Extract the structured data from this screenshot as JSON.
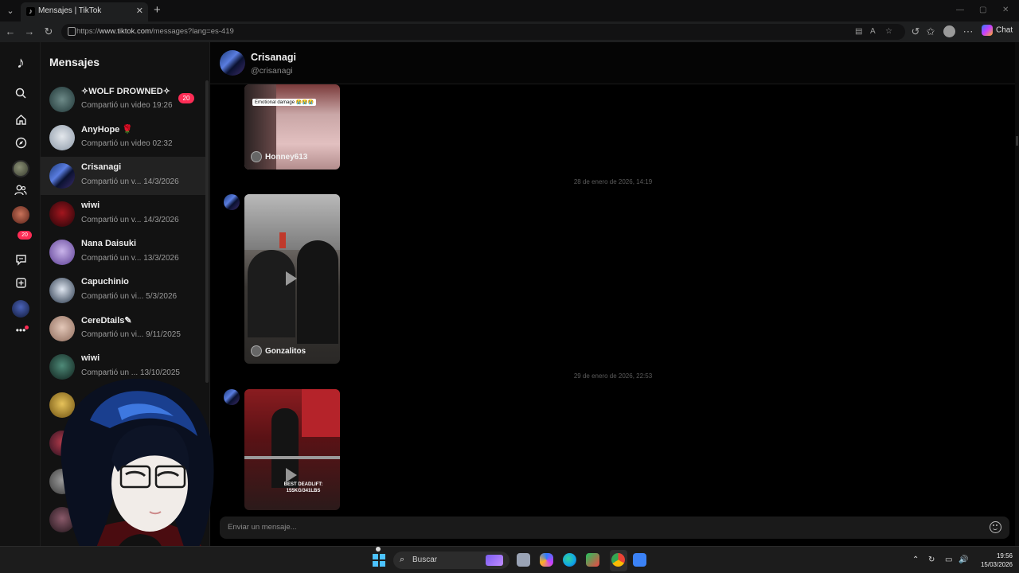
{
  "browser": {
    "tab_title": "Mensajes | TikTok",
    "url_prefix": "https://",
    "url_host": "www.tiktok.com",
    "url_path": "/messages?lang=es-419",
    "chat_label": "Chat"
  },
  "rail": {
    "badge": "20"
  },
  "conversations": {
    "title": "Mensajes",
    "items": [
      {
        "name": "✧WOLF DROWNED✧",
        "preview": "Compartió un video",
        "time": "19:26",
        "badge": "20"
      },
      {
        "name": "AnyHope 🌹",
        "preview": "Compartió un video",
        "time": "02:32"
      },
      {
        "name": "Crisanagi",
        "preview": "Compartió un v...",
        "time": "14/3/2026"
      },
      {
        "name": "wiwi",
        "preview": "Compartió un v...",
        "time": "14/3/2026"
      },
      {
        "name": "Nana Daisuki",
        "preview": "Compartió un v...",
        "time": "13/3/2026"
      },
      {
        "name": "Capuchinio",
        "preview": "Compartió un vi...",
        "time": "5/3/2026"
      },
      {
        "name": "CereDtails✎",
        "preview": "Compartió un vi...",
        "time": "9/11/2025"
      },
      {
        "name": "wiwi",
        "preview": "Compartió un ...",
        "time": "13/10/2025"
      }
    ]
  },
  "chat": {
    "name": "Crisanagi",
    "handle": "@crisanagi",
    "messages": [
      {
        "author": "Honney613",
        "caption": "Emotional damage 😭😭😭"
      },
      {
        "timestamp": "28 de enero de 2026, 14:19",
        "author": "Gonzalitos"
      },
      {
        "timestamp": "29 de enero de 2026, 22:53",
        "caption": "BEST DEADLIFT: 155KG/341LBS"
      }
    ],
    "composer_placeholder": "Enviar un mensaje..."
  },
  "taskbar": {
    "search_label": "Buscar",
    "time": "19:56",
    "date": "15/03/2026"
  }
}
